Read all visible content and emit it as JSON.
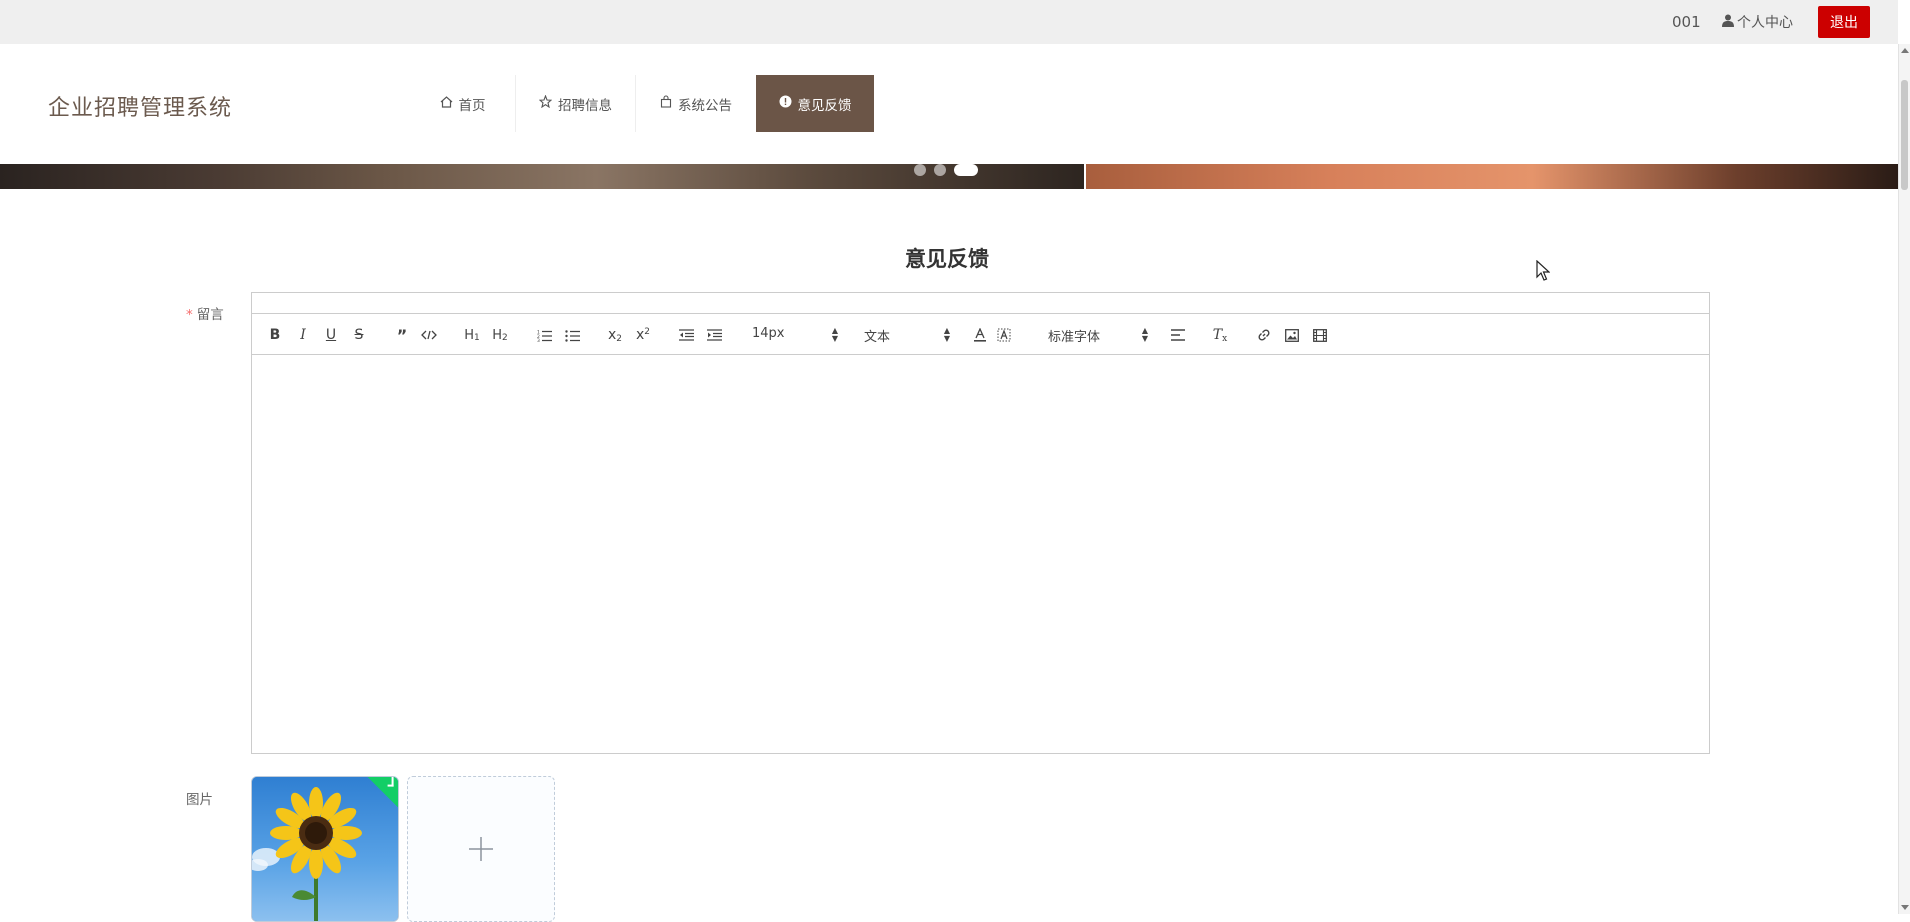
{
  "topbar": {
    "user_id": "001",
    "profile_label": "个人中心",
    "logout_label": "退出"
  },
  "header": {
    "brand": "企业招聘管理系统",
    "nav": [
      {
        "label": "首页",
        "icon": "home-icon"
      },
      {
        "label": "招聘信息",
        "icon": "star-icon"
      },
      {
        "label": "系统公告",
        "icon": "bag-icon"
      },
      {
        "label": "意见反馈",
        "icon": "info-icon",
        "active": true
      }
    ]
  },
  "banner": {
    "slides": 3,
    "active_slide": 3
  },
  "page": {
    "title": "意见反馈"
  },
  "form": {
    "message_label": "留言",
    "image_label": "图片",
    "editor": {
      "font_size": "14px",
      "heading": "文本",
      "font_family": "标准字体",
      "content": ""
    },
    "uploaded_image": "sunflower"
  },
  "colors": {
    "accent": "#6b5547",
    "logout": "#cc0000",
    "brand_text": "#6b5a4e",
    "success": "#13ce66"
  }
}
